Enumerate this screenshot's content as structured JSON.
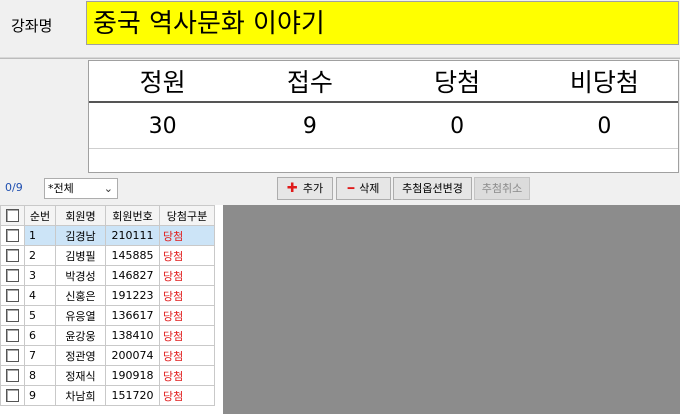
{
  "course": {
    "label": "강좌명",
    "value": "중국 역사문화 이야기"
  },
  "stats": {
    "headers": [
      "정원",
      "접수",
      "당첨",
      "비당첨"
    ],
    "values": [
      "30",
      "9",
      "0",
      "0"
    ]
  },
  "toolbar": {
    "counter": "0/9",
    "filter_value": "*전체",
    "add_label": "추가",
    "delete_label": "삭제",
    "option_label": "추첨옵션변경",
    "cancel_label": "추첨취소"
  },
  "table": {
    "columns": [
      "순번",
      "회원명",
      "회원번호",
      "당첨구분"
    ],
    "rows": [
      {
        "no": "1",
        "name": "김경남",
        "id": "210111",
        "result": "당첨"
      },
      {
        "no": "2",
        "name": "김병필",
        "id": "145885",
        "result": "당첨"
      },
      {
        "no": "3",
        "name": "박경성",
        "id": "146827",
        "result": "당첨"
      },
      {
        "no": "4",
        "name": "신홍은",
        "id": "191223",
        "result": "당첨"
      },
      {
        "no": "5",
        "name": "유응열",
        "id": "136617",
        "result": "당첨"
      },
      {
        "no": "6",
        "name": "윤강웅",
        "id": "138410",
        "result": "당첨"
      },
      {
        "no": "7",
        "name": "정관영",
        "id": "200074",
        "result": "당첨"
      },
      {
        "no": "8",
        "name": "정재식",
        "id": "190918",
        "result": "당첨"
      },
      {
        "no": "9",
        "name": "차남희",
        "id": "151720",
        "result": "당첨"
      }
    ]
  },
  "colors": {
    "highlight": "#ffff00",
    "selected_row": "#cce4f7",
    "win_text": "#e01b1b",
    "counter": "#1f4fb0"
  },
  "icons": {
    "add": "plus-icon",
    "delete": "minus-icon",
    "dropdown": "chevron-down-icon"
  }
}
